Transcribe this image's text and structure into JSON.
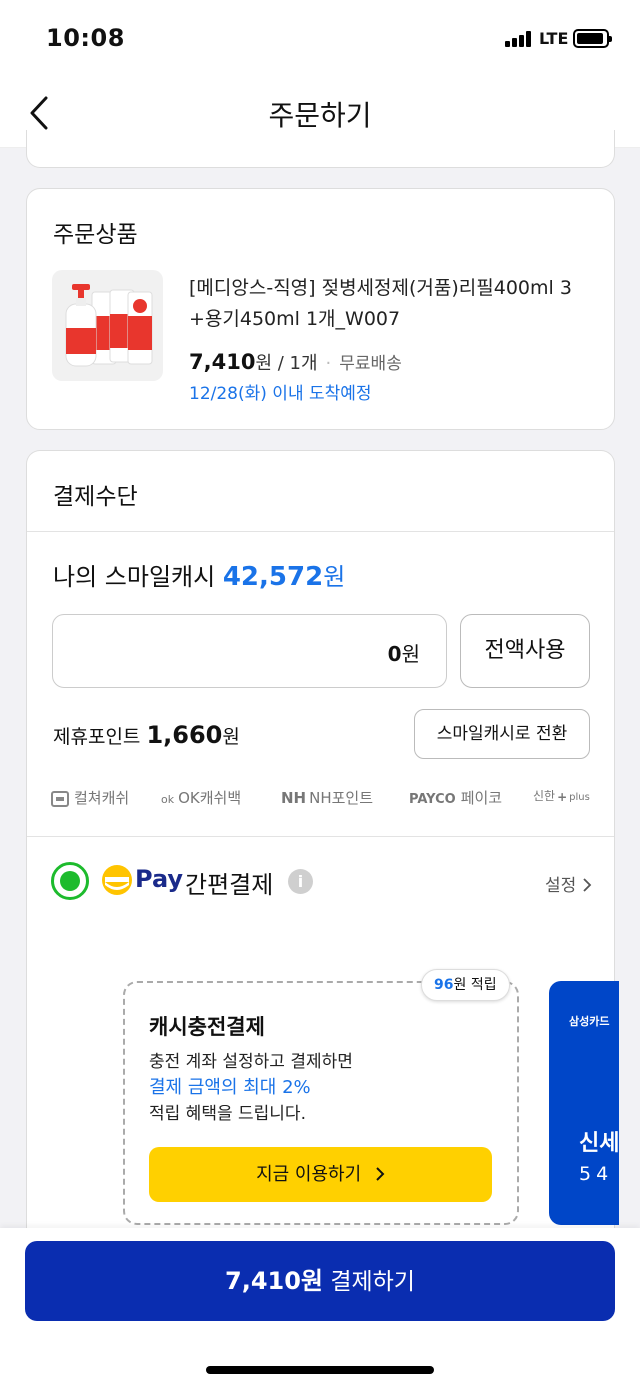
{
  "status_bar": {
    "time": "10:08",
    "network": "LTE"
  },
  "header": {
    "title": "주문하기"
  },
  "product_section": {
    "title": "주문상품",
    "product_name": "[메디앙스-직영] 젖병세정제(거품)리필400ml 3 +용기450ml 1개_W007",
    "price": "7,410",
    "price_unit": "원",
    "quantity": "/ 1개",
    "shipping": "무료배송",
    "arrival": "12/28(화) 이내 도착예정"
  },
  "payment_section": {
    "title": "결제수단",
    "smile_cash_label": "나의 스마일캐시",
    "smile_cash_amount": "42,572",
    "smile_cash_unit": "원",
    "input_value": "0",
    "input_unit": "원",
    "use_all_label": "전액사용",
    "partner_point_label": "제휴포인트",
    "partner_point_amount": "1,660",
    "partner_point_unit": "원",
    "convert_label": "스마일캐시로 전환",
    "partners": [
      "컬쳐캐쉬",
      "OK캐쉬백",
      "NH포인트",
      "페이코",
      "신한"
    ],
    "partner_brands": {
      "ok": "ok",
      "nh": "NH",
      "payco": "PAYCO",
      "shinhan_plus": "plus"
    },
    "pay_brand": "Pay",
    "pay_label": "간편결제",
    "settings_label": "설정",
    "promo": {
      "badge_amount": "96",
      "badge_suffix": "원 적립",
      "title": "캐시충전결제",
      "line1": "충전 계좌 설정하고 결제하면",
      "line2": "결제 금액의 최대 2%",
      "line3": "적립 혜택을 드립니다.",
      "button": "지금 이용하기"
    },
    "card": {
      "issuer": "삼성카드",
      "title": "신세",
      "number": "54"
    }
  },
  "bottom": {
    "amount": "7,410원",
    "action": "결제하기"
  },
  "colors": {
    "accent_blue": "#1a73e8",
    "pay_button": "#0a2db0",
    "radio_green": "#1dbb2d",
    "promo_button": "#ffd000"
  }
}
